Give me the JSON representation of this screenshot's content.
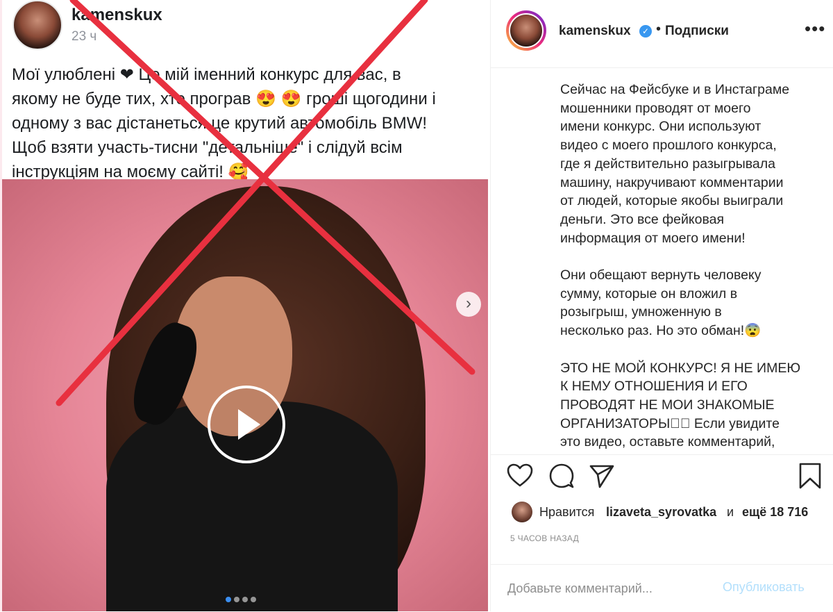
{
  "facebook_post": {
    "author": "kamenskux",
    "time": "23 ч",
    "text_lines": [
      "Мої улюблені ❤ Це мій іменний конкурс для вас, в",
      "якому не буде тих, хто програв 😍 😍 гроші щогодини і",
      "одному з вас дістанеться це крутий автомобіль BMW!",
      "Щоб взяти участь-тисни \"детальніше\" і слідуй всім",
      "інструкціям на моєму сайті! 🥰"
    ],
    "gallery_dots": 4,
    "cross_color": "#e8303f"
  },
  "instagram": {
    "username": "kamenskux",
    "separator": "•",
    "follow_label": "Подписки",
    "caption_lines": [
      "Сейчас на Фейсбуке и в Инстаграме",
      "мошенники проводят от моего",
      "имени конкурс. Они используют",
      "видео с моего прошлого конкурса,",
      "где я действительно разыгрывала",
      "машину, накручивают комментарии",
      "от людей, которые якобы выиграли",
      "деньги. Это все фейковая",
      "информация от моего имени!",
      "",
      "Они обещают вернуть человеку",
      "сумму, которые он вложил в",
      "розыгрыш, умноженную в",
      "несколько раз. Но это обман!😨",
      "",
      "ЭТО НЕ МОЙ КОНКУРС! Я НЕ ИМЕЮ",
      "К НЕМУ ОТНОШЕНИЯ И ЕГО",
      "ПРОВОДЯТ НЕ МОИ ЗНАКОМЫЕ",
      "ОРГАНИЗАТОРЫ⃞⃞ Если увидите",
      "это видео, оставьте комментарий,"
    ],
    "likes_prefix": "Нравится",
    "liker": "lizaveta_syrovatka",
    "likes_and": "и",
    "likes_more": "ещё 18 716",
    "time_ago": "5 ЧАСОВ НАЗАД",
    "comment_placeholder": "Добавьте комментарий...",
    "publish_label": "Опубликовать",
    "colors": {
      "verified": "#3897f0",
      "publish_disabled": "#b2dffc",
      "text": "#262626",
      "muted": "#8e8e8e"
    }
  }
}
